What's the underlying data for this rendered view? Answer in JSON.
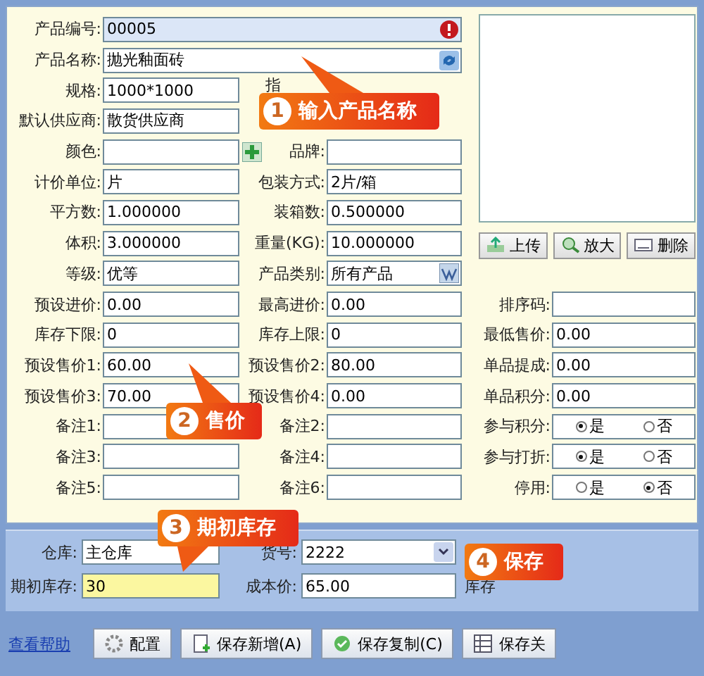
{
  "main_fields": [
    {
      "label": "产品编号:",
      "value": "00005",
      "kind": "readonly"
    },
    {
      "label": "产品名称:",
      "value": "抛光釉面砖",
      "kind": "refresh"
    },
    {
      "label": "规格:",
      "value": "1000*1000",
      "kind": "text"
    },
    {
      "label": "默认供应商:",
      "value": "散货供应商",
      "kind": "text"
    },
    {
      "label": "颜色:",
      "kind": "add"
    },
    {
      "label": "计价单位:",
      "value": "片",
      "kind": "text"
    },
    {
      "label": "平方数:",
      "value": "1.000000",
      "kind": "text"
    },
    {
      "label": "体积:",
      "value": "3.000000",
      "kind": "text"
    },
    {
      "label": "等级:",
      "value": "优等",
      "kind": "text"
    },
    {
      "label": "预设进价:",
      "value": "0.00",
      "kind": "text"
    },
    {
      "label": "库存下限:",
      "value": "0",
      "kind": "text"
    },
    {
      "label": "预设售价1:",
      "value": "60.00",
      "kind": "text"
    },
    {
      "label": "预设售价3:",
      "value": "70.00",
      "kind": "text"
    },
    {
      "label": "备注1:",
      "kind": "text"
    },
    {
      "label": "备注3:",
      "kind": "text"
    },
    {
      "label": "备注5:",
      "kind": "text"
    }
  ],
  "partial_label": "指",
  "middle_fields": [
    {
      "label": "品牌:",
      "kind": "text"
    },
    {
      "label": "包装方式:",
      "value": "2片/箱",
      "kind": "text"
    },
    {
      "label": "装箱数:",
      "value": "0.500000",
      "kind": "text"
    },
    {
      "label": "重量(KG):",
      "value": "10.000000",
      "kind": "text"
    },
    {
      "label": "产品类别:",
      "value": "所有产品",
      "kind": "lookup"
    },
    {
      "label": "最高进价:",
      "value": "0.00",
      "kind": "text"
    },
    {
      "label": "库存上限:",
      "value": "0",
      "kind": "text"
    },
    {
      "label": "预设售价2:",
      "value": "80.00",
      "kind": "text"
    },
    {
      "label": "预设售价4:",
      "value": "0.00",
      "kind": "text"
    },
    {
      "label": "备注2:",
      "kind": "text"
    },
    {
      "label": "备注4:",
      "kind": "text"
    },
    {
      "label": "备注6:",
      "kind": "text"
    }
  ],
  "image_buttons": [
    "上传",
    "放大",
    "删除"
  ],
  "right_fields": [
    {
      "label": "排序码:",
      "kind": "text"
    },
    {
      "label": "最低售价:",
      "value": "0.00",
      "kind": "text"
    },
    {
      "label": "单品提成:",
      "value": "0.00",
      "kind": "text"
    },
    {
      "label": "单品积分:",
      "value": "0.00",
      "kind": "text"
    },
    {
      "label": "参与积分:",
      "kind": "radio",
      "options": [
        {
          "label": "是",
          "selected": true
        },
        {
          "label": "否",
          "selected": false
        }
      ]
    },
    {
      "label": "参与打折:",
      "kind": "radio",
      "options": [
        {
          "label": "是",
          "selected": true
        },
        {
          "label": "否",
          "selected": false
        }
      ]
    },
    {
      "label": "停用:",
      "kind": "radio",
      "options": [
        {
          "label": "是",
          "selected": false
        },
        {
          "label": "否",
          "selected": true
        }
      ]
    }
  ],
  "stock_fields": [
    {
      "label": "仓库:",
      "value": "主仓库",
      "kind": "text",
      "highlighted": false
    },
    {
      "label": "货号:",
      "value": "2222",
      "kind": "select",
      "highlighted": false
    },
    {
      "label": "期初库存:",
      "value": "30",
      "kind": "text",
      "highlighted": true
    },
    {
      "label": "成本价:",
      "value": "65.00",
      "kind": "text",
      "highlighted": false
    }
  ],
  "stock_partial_label": "库存",
  "help_link": "查看帮助",
  "buttons": [
    {
      "label": "配置",
      "kind": "config"
    },
    {
      "label": "保存新增(A)",
      "kind": "new"
    },
    {
      "label": "保存复制(C)",
      "kind": "copy"
    },
    {
      "label": "保存关",
      "kind": "close"
    }
  ],
  "callouts": [
    {
      "number": "1",
      "text": "输入产品名称"
    },
    {
      "number": "2",
      "text": "售价"
    },
    {
      "number": "3",
      "text": "期初库存"
    },
    {
      "number": "4",
      "text": "保存"
    }
  ]
}
